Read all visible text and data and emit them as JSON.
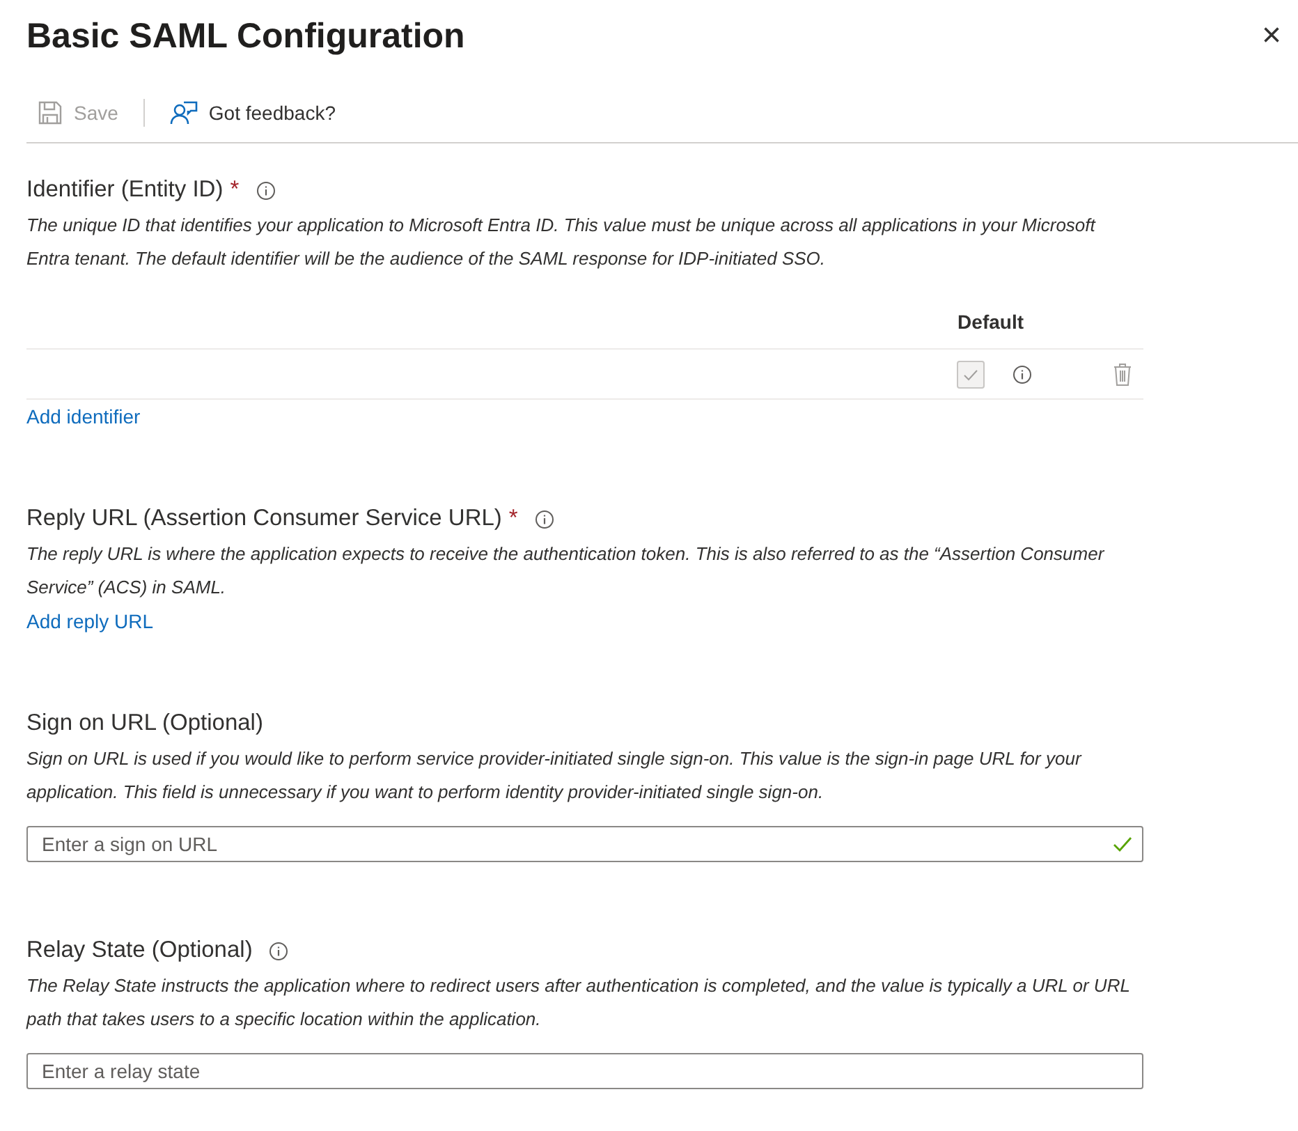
{
  "panel": {
    "title": "Basic SAML Configuration",
    "close": "×"
  },
  "toolbar": [
    {
      "kind": "save",
      "label": "Save",
      "disabled": true
    },
    {
      "kind": "feedback",
      "label": "Got feedback?",
      "disabled": false
    }
  ],
  "sections": [
    {
      "title": "Identifier (Entity ID)",
      "required_mark": "*",
      "info": true,
      "description": "The unique ID that identifies your application to Microsoft Entra ID. This value must be unique across all applications in your Microsoft Entra tenant. The default identifier will be the audience of the SAML response for IDP-initiated SSO.",
      "table": {
        "header": "Default",
        "rows": [
          {
            "checked": true,
            "disabled": true
          }
        ]
      },
      "link": "Add identifier"
    },
    {
      "title": "Reply URL (Assertion Consumer Service URL)",
      "required_mark": "*",
      "info": true,
      "description": "The reply URL is where the application expects to receive the authentication token. This is also referred to as the “Assertion Consumer Service” (ACS) in SAML.",
      "link": "Add reply URL"
    },
    {
      "title": "Sign on URL (Optional)",
      "info": false,
      "description": "Sign on URL is used if you would like to perform service provider-initiated single sign-on. This value is the sign-in page URL for your application. This field is unnecessary if you want to perform identity provider-initiated single sign-on.",
      "field": {
        "placeholder": "Enter a sign on URL",
        "valid": true
      }
    },
    {
      "title": "Relay State (Optional)",
      "info": true,
      "description": "The Relay State instructs the application where to redirect users after authentication is completed, and the value is typically a URL or URL path that takes users to a specific location within the application.",
      "field": {
        "placeholder": "Enter a relay state",
        "valid": false
      }
    }
  ]
}
